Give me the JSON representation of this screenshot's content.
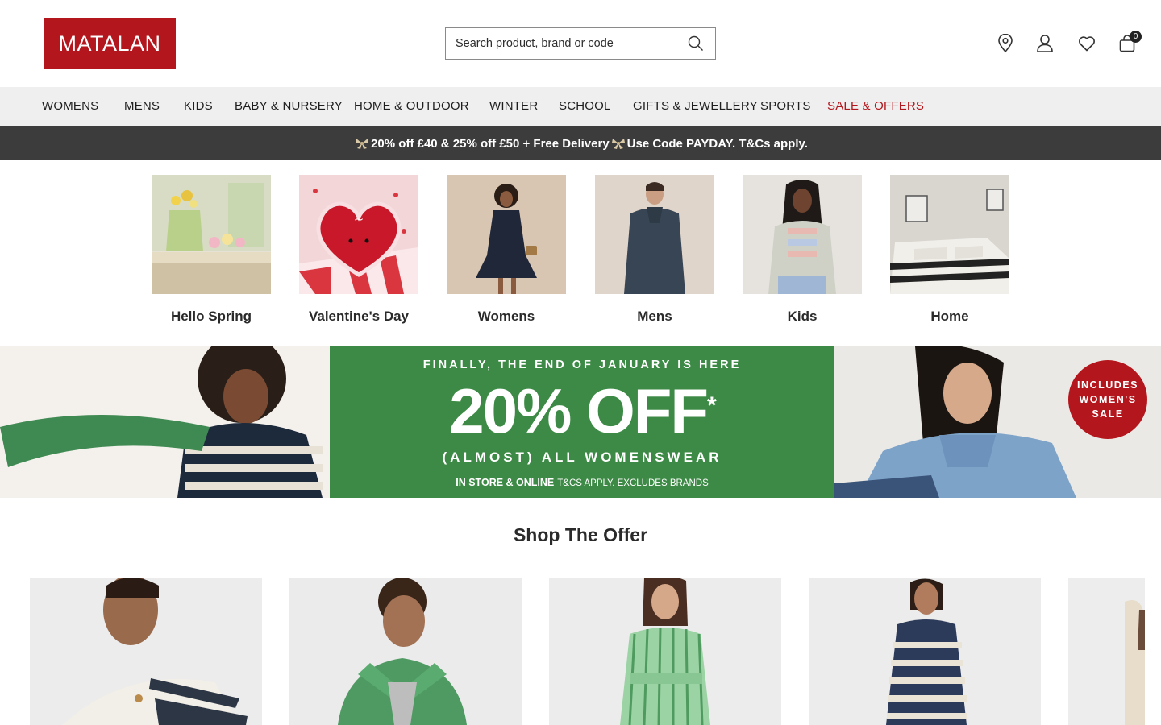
{
  "header": {
    "logo_text": "MATALAN",
    "brand_color": "#b3161c",
    "search_placeholder": "Search product, brand or code",
    "icons": [
      "store-locator-icon",
      "account-icon",
      "wishlist-heart-icon",
      "bag-icon"
    ],
    "bag_count": "0"
  },
  "nav": {
    "items": [
      "WOMENS",
      "MENS",
      "KIDS",
      "BABY & NURSERY",
      "HOME & OUTDOOR",
      "WINTER",
      "SCHOOL",
      "GIFTS & JEWELLERY",
      "SPORTS",
      "SALE & OFFERS"
    ],
    "sale_color": "#b3161c"
  },
  "promo_strip": {
    "part1": "20% off £40 & 25% off £50 + Free Delivery",
    "part2": "Use Code PAYDAY. T&Cs apply.",
    "background": "#3c3c3c"
  },
  "categories": [
    {
      "label": "Hello Spring"
    },
    {
      "label": "Valentine's Day"
    },
    {
      "label": "Womens"
    },
    {
      "label": "Mens"
    },
    {
      "label": "Kids"
    },
    {
      "label": "Home"
    }
  ],
  "hero": {
    "eyebrow": "FINALLY, THE END OF JANUARY IS HERE",
    "headline": "20% OFF",
    "asterisk": "*",
    "subline": "(ALMOST) ALL WOMENSWEAR",
    "channel": "IN STORE & ONLINE",
    "terms": "T&CS APPLY. EXCLUDES BRANDS",
    "badge_line1": "INCLUDES",
    "badge_line2": "WOMEN'S",
    "badge_line3": "SALE",
    "green": "#3c8a45"
  },
  "shop_offer": {
    "title": "Shop The Offer",
    "product_count_visible": 5
  }
}
